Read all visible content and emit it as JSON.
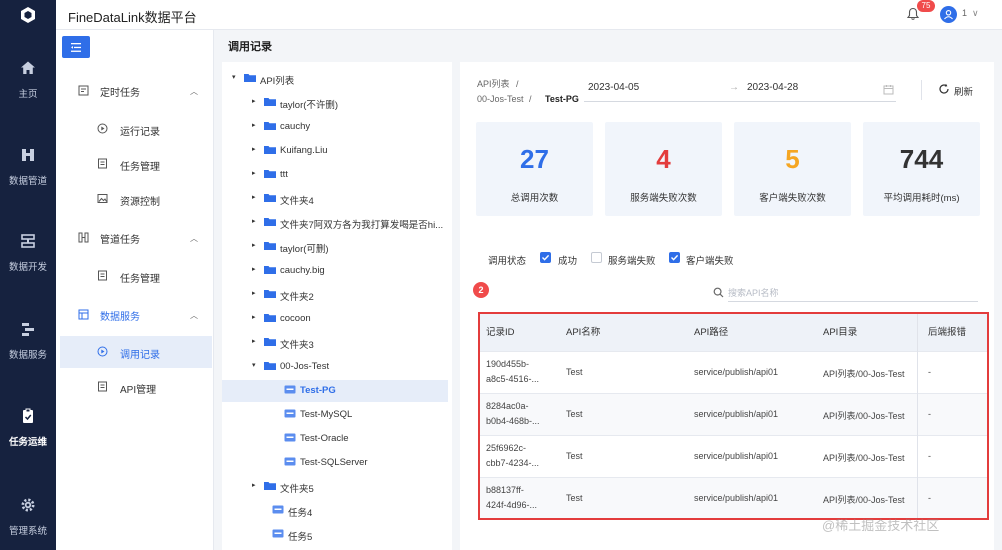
{
  "app": {
    "title": "FineDataLink数据平台"
  },
  "header": {
    "notification_count": "75",
    "user_name": "1",
    "user_chevron": "∨"
  },
  "leftnav": [
    {
      "label": "主页",
      "icon": "home-icon"
    },
    {
      "label": "数据管道",
      "icon": "pipeline-icon"
    },
    {
      "label": "数据开发",
      "icon": "dev-icon"
    },
    {
      "label": "数据服务",
      "icon": "service-icon"
    },
    {
      "label": "任务运维",
      "icon": "ops-icon",
      "active": true
    },
    {
      "label": "管理系统",
      "icon": "gear-icon"
    }
  ],
  "subnav": {
    "group1": {
      "label": "定时任务"
    },
    "items1": [
      {
        "label": "运行记录"
      },
      {
        "label": "任务管理"
      },
      {
        "label": "资源控制"
      }
    ],
    "group2": {
      "label": "管道任务"
    },
    "items2": [
      {
        "label": "任务管理"
      }
    ],
    "group3": {
      "label": "数据服务"
    },
    "items3": [
      {
        "label": "调用记录",
        "active": true
      },
      {
        "label": "API管理"
      }
    ]
  },
  "page": {
    "title": "调用记录"
  },
  "tree": [
    {
      "label": "API列表",
      "level": 0,
      "expanded": true
    },
    {
      "label": "taylor(不许删)",
      "level": 1
    },
    {
      "label": "cauchy",
      "level": 1
    },
    {
      "label": "Kuifang.Liu",
      "level": 1
    },
    {
      "label": "ttt",
      "level": 1
    },
    {
      "label": "文件夹4",
      "level": 1
    },
    {
      "label": "文件夹7阿双方各为我打算发喝是否hi...",
      "level": 1
    },
    {
      "label": "taylor(可删)",
      "level": 1
    },
    {
      "label": "cauchy.big",
      "level": 1
    },
    {
      "label": "文件夹2",
      "level": 1
    },
    {
      "label": "cocoon",
      "level": 1
    },
    {
      "label": "文件夹3",
      "level": 1
    },
    {
      "label": "00-Jos-Test",
      "level": 1,
      "expanded": true
    },
    {
      "label": "Test-PG",
      "level": 2,
      "api": true,
      "active": true
    },
    {
      "label": "Test-MySQL",
      "level": 2,
      "api": true
    },
    {
      "label": "Test-Oracle",
      "level": 2,
      "api": true
    },
    {
      "label": "Test-SQLServer",
      "level": 2,
      "api": true
    },
    {
      "label": "文件夹5",
      "level": 1
    },
    {
      "label": "任务4",
      "level": 1,
      "api": true
    },
    {
      "label": "任务5",
      "level": 1,
      "api": true
    }
  ],
  "breadcrumb": {
    "part1": "API列表",
    "sep": "/",
    "part2": "00-Jos-Test",
    "sep2": "/",
    "current": "Test-PG"
  },
  "date_range": {
    "start": "2023-04-05",
    "arrow": "→",
    "end": "2023-04-28"
  },
  "refresh_label": "刷新",
  "stats": [
    {
      "value": "27",
      "label": "总调用次数",
      "color": "#2f6ee8"
    },
    {
      "value": "4",
      "label": "服务端失败次数",
      "color": "#e33c3c"
    },
    {
      "value": "5",
      "label": "客户端失败次数",
      "color": "#f5a623"
    },
    {
      "value": "744",
      "label": "平均调用耗时(ms)",
      "color": "#333333"
    }
  ],
  "filters": {
    "label": "调用状态",
    "options": [
      {
        "label": "成功",
        "checked": true
      },
      {
        "label": "服务端失败",
        "checked": false
      },
      {
        "label": "客户端失败",
        "checked": true
      }
    ]
  },
  "marker": "2",
  "search": {
    "placeholder": "搜索API名称"
  },
  "table": {
    "headers": [
      "记录ID",
      "API名称",
      "API路径",
      "API目录",
      "后端报错"
    ],
    "rows": [
      {
        "id1": "190d455b-",
        "id2": "a8c5-4516-...",
        "name": "Test",
        "path": "service/publish/api01",
        "dir": "API列表/00-Jos-Test",
        "error": "-"
      },
      {
        "id1": "8284ac0a-",
        "id2": "b0b4-468b-...",
        "name": "Test",
        "path": "service/publish/api01",
        "dir": "API列表/00-Jos-Test",
        "error": "-"
      },
      {
        "id1": "25f6962c-",
        "id2": "cbb7-4234-...",
        "name": "Test",
        "path": "service/publish/api01",
        "dir": "API列表/00-Jos-Test",
        "error": "-"
      },
      {
        "id1": "b88137ff-",
        "id2": "424f-4d96-...",
        "name": "Test",
        "path": "service/publish/api01",
        "dir": "API列表/00-Jos-Test",
        "error": "-"
      }
    ]
  },
  "watermark": "@稀土掘金技术社区"
}
